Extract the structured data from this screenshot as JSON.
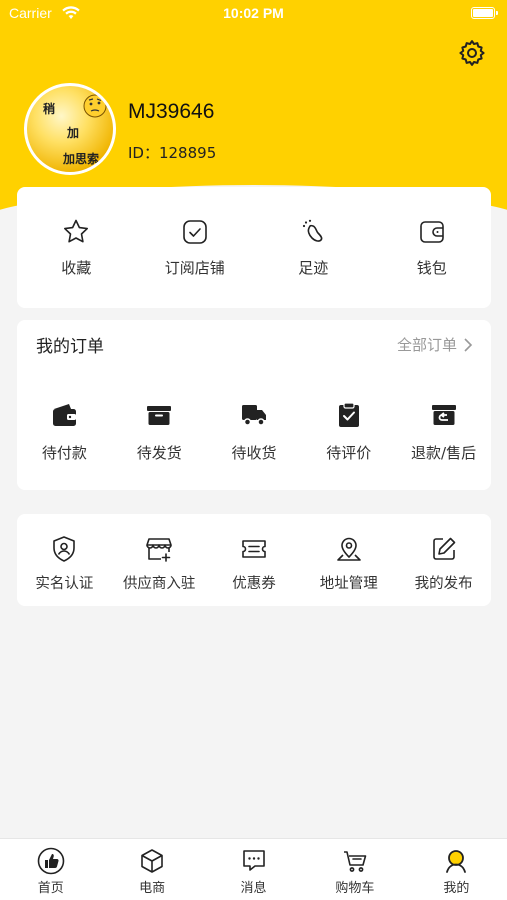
{
  "status_bar": {
    "carrier": "Carrier",
    "time": "10:02 PM"
  },
  "profile": {
    "name": "MJ39646",
    "id_text": "ID：128895",
    "avatar_text": [
      "稍",
      "加",
      "加思索"
    ]
  },
  "quick_actions": [
    {
      "label": "收藏",
      "icon": "star-icon"
    },
    {
      "label": "订阅店铺",
      "icon": "check-square-icon"
    },
    {
      "label": "足迹",
      "icon": "footprint-icon"
    },
    {
      "label": "钱包",
      "icon": "wallet-icon"
    }
  ],
  "orders": {
    "title": "我的订单",
    "view_all": "全部订单",
    "items": [
      {
        "label": "待付款",
        "icon": "wallet-pay-icon"
      },
      {
        "label": "待发货",
        "icon": "box-icon"
      },
      {
        "label": "待收货",
        "icon": "truck-icon"
      },
      {
        "label": "待评价",
        "icon": "clipboard-check-icon"
      },
      {
        "label": "退款/售后",
        "icon": "refund-icon"
      }
    ]
  },
  "services": [
    {
      "label": "实名认证",
      "icon": "shield-user-icon"
    },
    {
      "label": "供应商入驻",
      "icon": "store-add-icon"
    },
    {
      "label": "优惠券",
      "icon": "coupon-icon"
    },
    {
      "label": "地址管理",
      "icon": "location-icon"
    },
    {
      "label": "我的发布",
      "icon": "edit-icon"
    }
  ],
  "tabs": [
    {
      "label": "首页",
      "icon": "thumbs-up-icon",
      "active": false
    },
    {
      "label": "电商",
      "icon": "cube-icon",
      "active": false
    },
    {
      "label": "消息",
      "icon": "message-icon",
      "active": false
    },
    {
      "label": "购物车",
      "icon": "cart-icon",
      "active": false
    },
    {
      "label": "我的",
      "icon": "user-icon",
      "active": true
    }
  ],
  "colors": {
    "accent": "#ffd100",
    "active_tab": "#ffd100"
  }
}
